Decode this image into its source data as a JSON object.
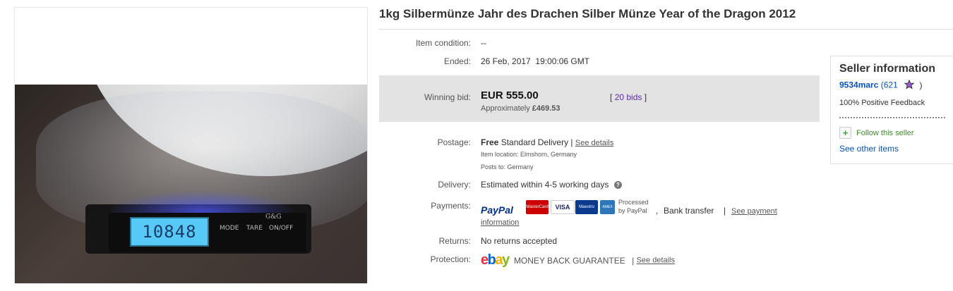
{
  "photo": {
    "scale_reading": "10848",
    "buttons": [
      "MODE",
      "TARE",
      "ON/OFF"
    ],
    "brand": "G&G"
  },
  "title": "1kg Silbermünze Jahr des Drachen Silber Münze Year of the Dragon 2012",
  "condition": {
    "label": "Item condition:",
    "value": "--"
  },
  "ended": {
    "label": "Ended:",
    "value": "26 Feb, 2017  19:00:06 GMT"
  },
  "winning_bid": {
    "label": "Winning bid:",
    "price": "EUR 555.00",
    "approx_prefix": "Approximately",
    "approx_value": "£469.53",
    "bids_open": "[",
    "bids_link": "20 bids",
    "bids_close": "]"
  },
  "postage": {
    "label": "Postage:",
    "free": "Free",
    "service": "Standard Delivery |",
    "details_link": "See details",
    "location": "Item location:  Elmshorn, Germany",
    "posts_to": "Posts to:  Germany"
  },
  "delivery": {
    "label": "Delivery:",
    "value": "Estimated within 4-5 working days",
    "help": "?"
  },
  "payments": {
    "label": "Payments:",
    "paypal_text": "PayPal",
    "cards": [
      "MasterCard",
      "VISA",
      "Maestro",
      "AMEX"
    ],
    "processed_line1": "Processed",
    "processed_line2": "by PayPal",
    "bank": "Bank transfer",
    "see_payment_1": "See payment",
    "see_payment_2": "information"
  },
  "returns": {
    "label": "Returns:",
    "value": "No returns accepted"
  },
  "protection": {
    "label": "Protection:",
    "ebay_letters": [
      "e",
      "b",
      "a",
      "y"
    ],
    "guarantee": "MONEY BACK GUARANTEE",
    "details_link": "See details"
  },
  "seller": {
    "heading": "Seller information",
    "username": "9534marc",
    "score": "(621",
    "score_close": ")",
    "feedback": "100% Positive Feedback",
    "follow": "Follow this seller",
    "see_other": "See other items"
  },
  "colors": {
    "link": "#0654ba",
    "bid_box": "#e3e3e3",
    "paypal_dark": "#003087",
    "paypal_light": "#009cde",
    "ebay": [
      "#e53238",
      "#0064d2",
      "#f5af02",
      "#86b817"
    ]
  }
}
